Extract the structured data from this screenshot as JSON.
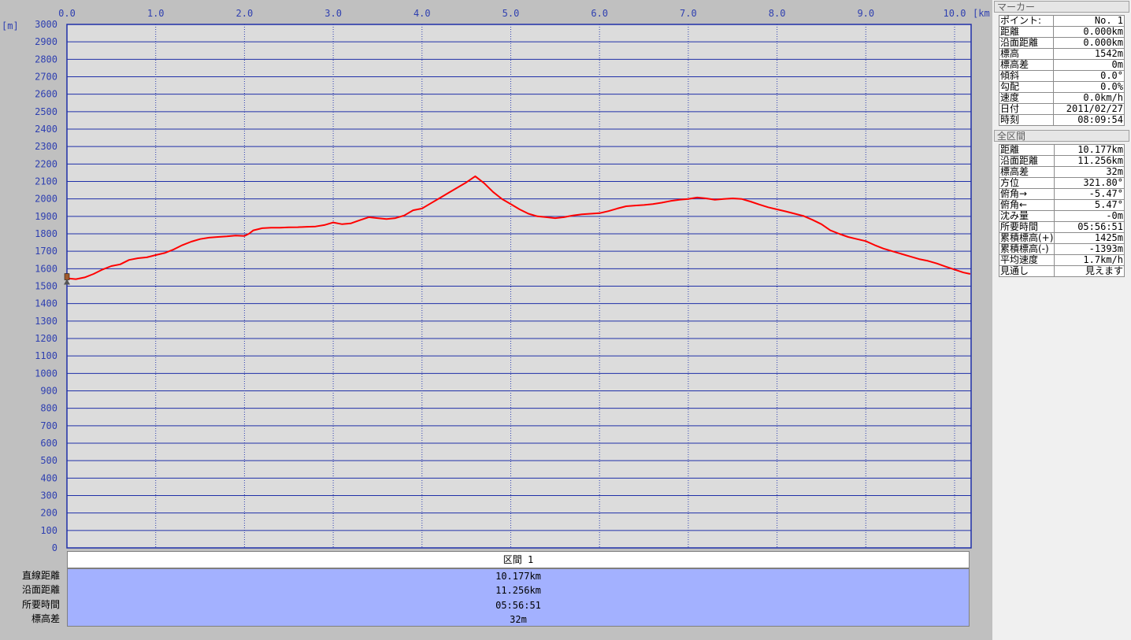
{
  "chart_data": {
    "type": "line",
    "xlabel_unit": "[km]",
    "ylabel_unit": "[m]",
    "xlim": [
      0,
      10.177
    ],
    "ylim": [
      0,
      3000
    ],
    "x_ticks": [
      "0.0",
      "1.0",
      "2.0",
      "3.0",
      "4.0",
      "5.0",
      "6.0",
      "7.0",
      "8.0",
      "9.0",
      "10.0"
    ],
    "y_ticks": [
      "3000",
      "2900",
      "2800",
      "2700",
      "2600",
      "2500",
      "2400",
      "2300",
      "2200",
      "2100",
      "2000",
      "1900",
      "1800",
      "1700",
      "1600",
      "1500",
      "1400",
      "1300",
      "1200",
      "1100",
      "1000",
      "900",
      "800",
      "700",
      "600",
      "500",
      "400",
      "300",
      "200",
      "100",
      "0"
    ],
    "grid": true,
    "series": [
      {
        "color": "#ff0000",
        "x": [
          0.0,
          0.1,
          0.2,
          0.3,
          0.4,
          0.5,
          0.6,
          0.7,
          0.8,
          0.9,
          1.0,
          1.1,
          1.2,
          1.3,
          1.4,
          1.5,
          1.6,
          1.7,
          1.8,
          1.9,
          2.0,
          2.05,
          2.1,
          2.2,
          2.3,
          2.4,
          2.5,
          2.6,
          2.7,
          2.8,
          2.9,
          3.0,
          3.1,
          3.2,
          3.3,
          3.4,
          3.5,
          3.6,
          3.7,
          3.8,
          3.9,
          4.0,
          4.1,
          4.2,
          4.3,
          4.4,
          4.5,
          4.6,
          4.7,
          4.8,
          4.9,
          5.0,
          5.1,
          5.2,
          5.3,
          5.4,
          5.5,
          5.6,
          5.7,
          5.8,
          5.9,
          6.0,
          6.1,
          6.2,
          6.3,
          6.4,
          6.5,
          6.6,
          6.7,
          6.8,
          6.9,
          7.0,
          7.1,
          7.2,
          7.3,
          7.4,
          7.5,
          7.6,
          7.7,
          7.8,
          7.9,
          8.0,
          8.1,
          8.2,
          8.3,
          8.4,
          8.5,
          8.6,
          8.7,
          8.8,
          8.9,
          9.0,
          9.1,
          9.2,
          9.3,
          9.4,
          9.5,
          9.6,
          9.7,
          9.8,
          9.9,
          10.0,
          10.1,
          10.177
        ],
        "y": [
          1545,
          1540,
          1550,
          1570,
          1595,
          1615,
          1625,
          1650,
          1660,
          1665,
          1678,
          1690,
          1710,
          1735,
          1755,
          1770,
          1778,
          1782,
          1785,
          1790,
          1788,
          1800,
          1820,
          1832,
          1835,
          1835,
          1837,
          1838,
          1840,
          1842,
          1850,
          1865,
          1855,
          1860,
          1878,
          1895,
          1890,
          1885,
          1890,
          1905,
          1935,
          1945,
          1975,
          2005,
          2035,
          2065,
          2095,
          2130,
          2090,
          2040,
          2000,
          1970,
          1940,
          1915,
          1900,
          1895,
          1890,
          1895,
          1905,
          1912,
          1915,
          1918,
          1930,
          1945,
          1958,
          1962,
          1965,
          1970,
          1978,
          1988,
          1995,
          2000,
          2008,
          2003,
          1995,
          2000,
          2003,
          2000,
          1985,
          1968,
          1952,
          1940,
          1928,
          1915,
          1902,
          1880,
          1855,
          1820,
          1800,
          1782,
          1770,
          1758,
          1735,
          1715,
          1700,
          1685,
          1670,
          1655,
          1645,
          1630,
          1612,
          1595,
          1578,
          1570
        ]
      }
    ]
  },
  "segment": {
    "header": "区間 1",
    "labels": [
      "直線距離",
      "沿面距離",
      "所要時間",
      "標高差"
    ],
    "values": [
      "10.177km",
      "11.256km",
      "05:56:51",
      "32m"
    ]
  },
  "marker_panel": {
    "title": "マーカー",
    "rows": [
      {
        "k": "ポイント:",
        "v": "No. 1"
      },
      {
        "k": "距離",
        "v": "0.000km"
      },
      {
        "k": "沿面距離",
        "v": "0.000km"
      },
      {
        "k": "標高",
        "v": "1542m"
      },
      {
        "k": "標高差",
        "v": "0m"
      },
      {
        "k": "傾斜",
        "v": "0.0°"
      },
      {
        "k": "勾配",
        "v": "0.0%"
      },
      {
        "k": "速度",
        "v": "0.0km/h"
      },
      {
        "k": "日付",
        "v": "2011/02/27"
      },
      {
        "k": "時刻",
        "v": "08:09:54"
      }
    ]
  },
  "total_panel": {
    "title": "全区間",
    "rows": [
      {
        "k": "距離",
        "v": "10.177km"
      },
      {
        "k": "沿面距離",
        "v": "11.256km"
      },
      {
        "k": "標高差",
        "v": "32m"
      },
      {
        "k": "方位",
        "v": "321.80°"
      },
      {
        "k": "俯角→",
        "v": "-5.47°"
      },
      {
        "k": "俯角←",
        "v": "5.47°"
      },
      {
        "k": "沈み量",
        "v": "-0m"
      },
      {
        "k": "所要時間",
        "v": "05:56:51"
      },
      {
        "k": "累積標高(+)",
        "v": "1425m"
      },
      {
        "k": "累積標高(-)",
        "v": "-1393m"
      },
      {
        "k": "平均速度",
        "v": "1.7km/h"
      },
      {
        "k": "見通し",
        "v": "見えます"
      }
    ]
  }
}
